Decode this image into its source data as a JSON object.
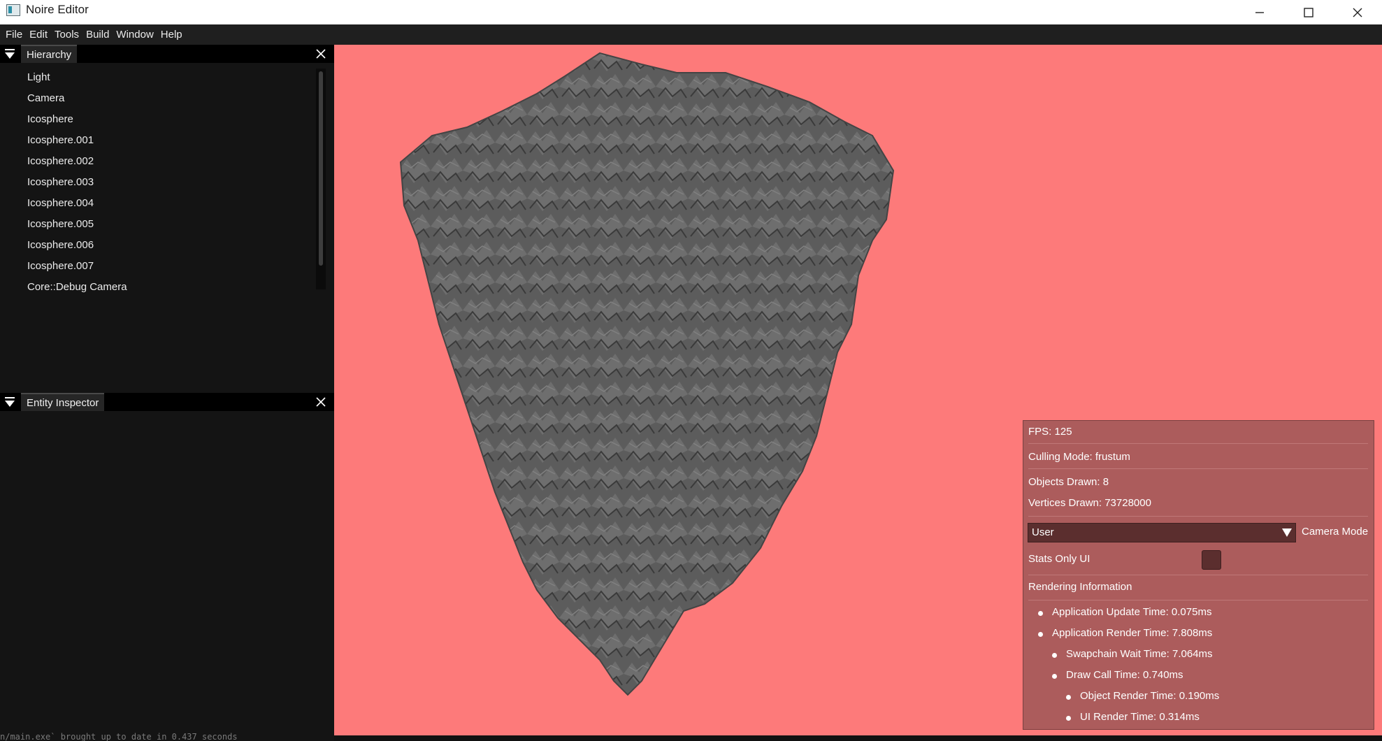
{
  "window": {
    "title": "Noire Editor",
    "controls": [
      "minimize",
      "maximize",
      "close"
    ]
  },
  "menubar": {
    "items": [
      "File",
      "Edit",
      "Tools",
      "Build",
      "Window",
      "Help"
    ]
  },
  "hierarchy": {
    "title": "Hierarchy",
    "items": [
      "Light",
      "Camera",
      "Icosphere",
      "Icosphere.001",
      "Icosphere.002",
      "Icosphere.003",
      "Icosphere.004",
      "Icosphere.005",
      "Icosphere.006",
      "Icosphere.007",
      "Core::Debug Camera"
    ]
  },
  "inspector": {
    "title": "Entity Inspector"
  },
  "console": {
    "text": "n/main.exe` brought up to date in 0.437 seconds"
  },
  "viewport": {
    "background_color": "#fd7a7a",
    "object_color": "#5a5a5a"
  },
  "stats": {
    "fps": "FPS: 125",
    "culling": "Culling Mode: frustum",
    "objects": "Objects Drawn: 8",
    "vertices": "Vertices Drawn: 73728000",
    "camera_mode_value": "User",
    "camera_mode_label": "Camera Mode",
    "stats_only_label": "Stats Only UI",
    "stats_only_checked": false,
    "rendering_header": "Rendering Information",
    "timings": [
      "Application Update Time: 0.075ms",
      "Application Render Time: 7.808ms",
      "Swapchain Wait Time: 7.064ms",
      "Draw Call Time: 0.740ms",
      "Object Render Time: 0.190ms",
      "UI Render Time: 0.314ms"
    ]
  }
}
